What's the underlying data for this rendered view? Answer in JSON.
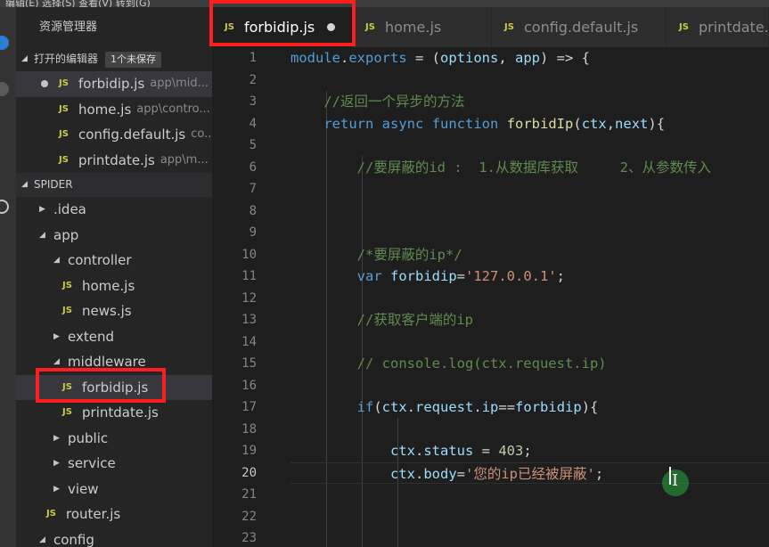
{
  "menubar": {
    "text": "编辑(E)   选择(S)   查看(V)   转到(G)"
  },
  "sidebar": {
    "title": "资源管理器",
    "open_editors": {
      "label": "打开的编辑器",
      "badge": "1个未保存",
      "items": [
        {
          "name": "forbidip.js",
          "path": "app\\mid...",
          "modified": true
        },
        {
          "name": "home.js",
          "path": "app\\contro..."
        },
        {
          "name": "config.default.js",
          "path": "co..."
        },
        {
          "name": "printdate.js",
          "path": "app\\m..."
        }
      ]
    },
    "project": {
      "label": "SPIDER",
      "tree": [
        {
          "name": ".idea",
          "kind": "folder-collapsed"
        },
        {
          "name": "app",
          "kind": "folder-expanded"
        },
        {
          "name": "controller",
          "kind": "folder-expanded"
        },
        {
          "name": "home.js",
          "kind": "js"
        },
        {
          "name": "news.js",
          "kind": "js"
        },
        {
          "name": "extend",
          "kind": "folder-collapsed"
        },
        {
          "name": "middleware",
          "kind": "folder-expanded"
        },
        {
          "name": "forbidip.js",
          "kind": "js"
        },
        {
          "name": "printdate.js",
          "kind": "js"
        },
        {
          "name": "public",
          "kind": "folder-collapsed"
        },
        {
          "name": "service",
          "kind": "folder-collapsed"
        },
        {
          "name": "view",
          "kind": "folder-collapsed"
        },
        {
          "name": "router.js",
          "kind": "js"
        },
        {
          "name": "config",
          "kind": "folder-expanded"
        }
      ]
    }
  },
  "tabs": [
    {
      "name": "forbidip.js",
      "active": true,
      "modified": true
    },
    {
      "name": "home.js"
    },
    {
      "name": "config.default.js"
    },
    {
      "name": "printdate.js"
    }
  ],
  "icons": {
    "file_js": "JS",
    "tree_collapsed": "▶",
    "tree_expanded": "◢"
  },
  "editor": {
    "current_line": 20,
    "lines": [
      "module.exports = (options, app) => {",
      "",
      "    //返回一个异步的方法",
      "    return async function forbidIp(ctx,next){",
      "",
      "        //要屏蔽的id :  1.从数据库获取     2、从参数传入",
      "",
      "",
      "",
      "        /*要屏蔽的ip*/",
      "        var forbidip='127.0.0.1';",
      "",
      "        //获取客户端的ip",
      "",
      "        // console.log(ctx.request.ip)",
      "",
      "        if(ctx.request.ip==forbidip){",
      "",
      "            ctx.status = 403;",
      "            ctx.body='您的ip已经被屏蔽';",
      "",
      "",
      ""
    ]
  },
  "colors": {
    "highlight_box": "#ff1e1e",
    "js_badge": "#cbcb41",
    "click_indicator": "#28aa3c"
  }
}
